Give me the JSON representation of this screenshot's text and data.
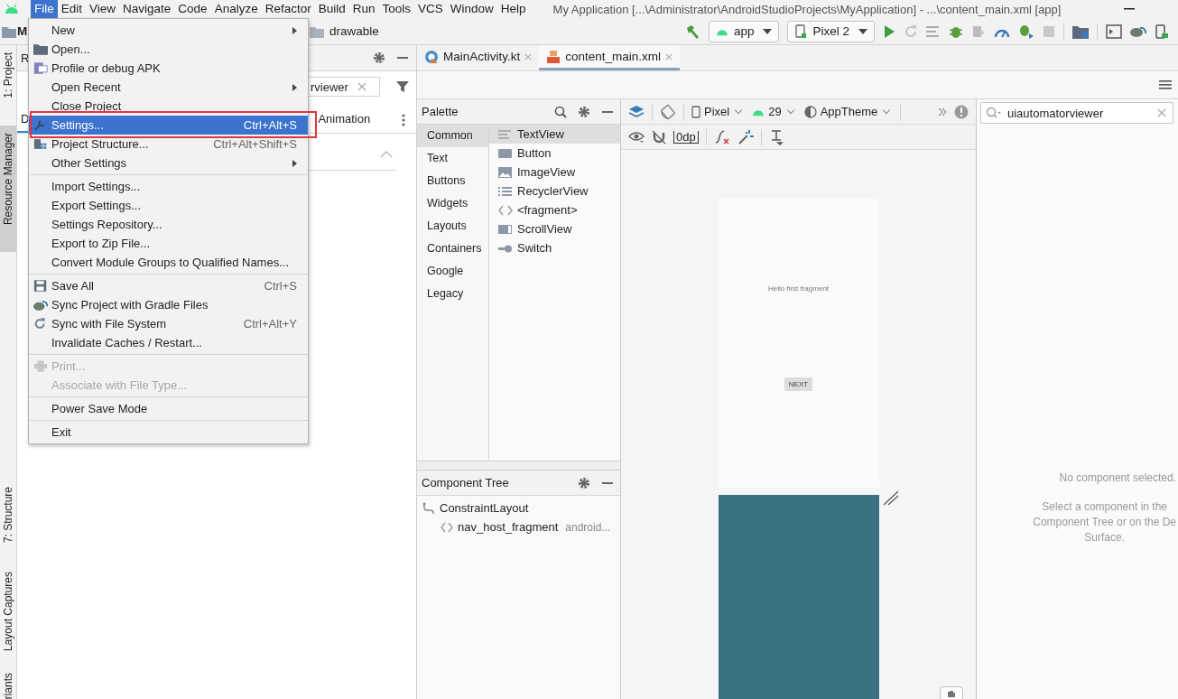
{
  "menubar": {
    "items": [
      {
        "label": "File",
        "selected": true
      },
      {
        "label": "Edit",
        "selected": false
      },
      {
        "label": "View",
        "selected": false
      },
      {
        "label": "Navigate",
        "selected": false
      },
      {
        "label": "Code",
        "selected": false
      },
      {
        "label": "Analyze",
        "selected": false
      },
      {
        "label": "Refactor",
        "selected": false
      },
      {
        "label": "Build",
        "selected": false
      },
      {
        "label": "Run",
        "selected": false
      },
      {
        "label": "Tools",
        "selected": false
      },
      {
        "label": "VCS",
        "selected": false
      },
      {
        "label": "Window",
        "selected": false
      },
      {
        "label": "Help",
        "selected": false
      }
    ]
  },
  "window": {
    "title": "My Application [...\\Administrator\\AndroidStudioProjects\\MyApplication] - ...\\content_main.xml [app]"
  },
  "navbar": {
    "project": "M",
    "folder": "drawable"
  },
  "toolbar": {
    "configuration": "app",
    "device": "Pixel 2"
  },
  "tool_strip": [
    {
      "label": "1: Project",
      "selected": false
    },
    {
      "label": "Resource Manager",
      "selected": true
    },
    {
      "label": "7: Structure",
      "selected": false
    },
    {
      "label": "Layout Captures",
      "selected": false
    },
    {
      "label": "riants",
      "selected": false
    }
  ],
  "left_panel": {
    "title": "R",
    "search": {
      "value": "rviewer"
    },
    "tabs": [
      {
        "label": "D",
        "selected": true
      },
      {
        "label": "Animation",
        "selected": false
      }
    ]
  },
  "editor_tabs": [
    {
      "label": "MainActivity.kt",
      "selected": false
    },
    {
      "label": "content_main.xml",
      "selected": true
    }
  ],
  "palette": {
    "title": "Palette",
    "categories": [
      {
        "label": "Common",
        "selected": true
      },
      {
        "label": "Text",
        "selected": false
      },
      {
        "label": "Buttons",
        "selected": false
      },
      {
        "label": "Widgets",
        "selected": false
      },
      {
        "label": "Layouts",
        "selected": false
      },
      {
        "label": "Containers",
        "selected": false
      },
      {
        "label": "Google",
        "selected": false
      },
      {
        "label": "Legacy",
        "selected": false
      }
    ],
    "items": [
      {
        "label": "TextView",
        "selected": true
      },
      {
        "label": "Button",
        "selected": false
      },
      {
        "label": "ImageView",
        "selected": false
      },
      {
        "label": "RecyclerView",
        "selected": false
      },
      {
        "label": "<fragment>",
        "selected": false
      },
      {
        "label": "ScrollView",
        "selected": false
      },
      {
        "label": "Switch",
        "selected": false
      }
    ]
  },
  "design_toolbar": {
    "device": "Pixel",
    "api": "29",
    "theme": "AppTheme",
    "margin": "0dp"
  },
  "preview": {
    "text": "Hello first fragment",
    "button": "NEXT"
  },
  "component_tree": {
    "title": "Component Tree",
    "nodes": [
      {
        "label": "ConstraintLayout",
        "children": [
          {
            "label": "nav_host_fragment",
            "detail": "android..."
          }
        ]
      }
    ]
  },
  "attributes": {
    "search": {
      "value": "uiautomatorviewer"
    },
    "empty_title": "No component selected.",
    "empty_lines": [
      "Select a component in the",
      "Component Tree or on the De",
      "Surface."
    ]
  },
  "file_menu": {
    "sections": [
      {
        "items": [
          {
            "label": "New",
            "kind": "submenu",
            "selected": false,
            "disabled": false,
            "boxed": false
          },
          {
            "label": "Open...",
            "kind": "command",
            "selected": false,
            "disabled": false,
            "boxed": false
          },
          {
            "label": "Profile or debug APK",
            "kind": "command",
            "selected": false,
            "disabled": false,
            "boxed": false
          },
          {
            "label": "Open Recent",
            "kind": "submenu",
            "selected": false,
            "disabled": false,
            "boxed": false
          },
          {
            "label": "Close Project",
            "kind": "command",
            "selected": false,
            "disabled": false,
            "boxed": false
          },
          {
            "label": "Settings...",
            "kind": "command",
            "shortcut": "Ctrl+Alt+S",
            "selected": true,
            "disabled": false,
            "boxed": true
          },
          {
            "label": "Project Structure...",
            "kind": "command",
            "shortcut": "Ctrl+Alt+Shift+S",
            "selected": false,
            "disabled": false,
            "boxed": false
          },
          {
            "label": "Other Settings",
            "kind": "submenu",
            "selected": false,
            "disabled": false,
            "boxed": false
          }
        ]
      },
      {
        "items": [
          {
            "label": "Import Settings...",
            "kind": "command",
            "selected": false,
            "disabled": false,
            "boxed": false
          },
          {
            "label": "Export Settings...",
            "kind": "command",
            "selected": false,
            "disabled": false,
            "boxed": false
          },
          {
            "label": "Settings Repository...",
            "kind": "command",
            "selected": false,
            "disabled": false,
            "boxed": false
          },
          {
            "label": "Export to Zip File...",
            "kind": "command",
            "selected": false,
            "disabled": false,
            "boxed": false
          },
          {
            "label": "Convert Module Groups to Qualified Names...",
            "kind": "command",
            "selected": false,
            "disabled": false,
            "boxed": false
          }
        ]
      },
      {
        "items": [
          {
            "label": "Save All",
            "kind": "command",
            "shortcut": "Ctrl+S",
            "selected": false,
            "disabled": false,
            "boxed": false
          },
          {
            "label": "Sync Project with Gradle Files",
            "kind": "command",
            "selected": false,
            "disabled": false,
            "boxed": false
          },
          {
            "label": "Sync with File System",
            "kind": "command",
            "shortcut": "Ctrl+Alt+Y",
            "selected": false,
            "disabled": false,
            "boxed": false
          },
          {
            "label": "Invalidate Caches / Restart...",
            "kind": "command",
            "selected": false,
            "disabled": false,
            "boxed": false
          }
        ]
      },
      {
        "items": [
          {
            "label": "Print...",
            "kind": "command",
            "selected": false,
            "disabled": true,
            "boxed": false
          },
          {
            "label": "Associate with File Type...",
            "kind": "command",
            "selected": false,
            "disabled": true,
            "boxed": false
          }
        ]
      },
      {
        "items": [
          {
            "label": "Power Save Mode",
            "kind": "command",
            "selected": false,
            "disabled": false,
            "boxed": false
          }
        ]
      },
      {
        "items": [
          {
            "label": "Exit",
            "kind": "command",
            "selected": false,
            "disabled": false,
            "boxed": false
          }
        ]
      }
    ]
  }
}
